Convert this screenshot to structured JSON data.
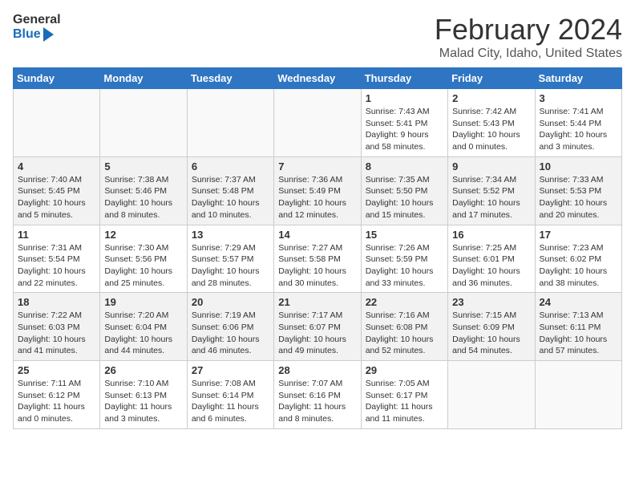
{
  "header": {
    "logo_general": "General",
    "logo_blue": "Blue",
    "month_title": "February 2024",
    "location": "Malad City, Idaho, United States"
  },
  "calendar": {
    "columns": [
      "Sunday",
      "Monday",
      "Tuesday",
      "Wednesday",
      "Thursday",
      "Friday",
      "Saturday"
    ],
    "rows": [
      {
        "shaded": false,
        "cells": [
          {
            "day": "",
            "info": ""
          },
          {
            "day": "",
            "info": ""
          },
          {
            "day": "",
            "info": ""
          },
          {
            "day": "",
            "info": ""
          },
          {
            "day": "1",
            "info": "Sunrise: 7:43 AM\nSunset: 5:41 PM\nDaylight: 9 hours and 58 minutes."
          },
          {
            "day": "2",
            "info": "Sunrise: 7:42 AM\nSunset: 5:43 PM\nDaylight: 10 hours and 0 minutes."
          },
          {
            "day": "3",
            "info": "Sunrise: 7:41 AM\nSunset: 5:44 PM\nDaylight: 10 hours and 3 minutes."
          }
        ]
      },
      {
        "shaded": true,
        "cells": [
          {
            "day": "4",
            "info": "Sunrise: 7:40 AM\nSunset: 5:45 PM\nDaylight: 10 hours and 5 minutes."
          },
          {
            "day": "5",
            "info": "Sunrise: 7:38 AM\nSunset: 5:46 PM\nDaylight: 10 hours and 8 minutes."
          },
          {
            "day": "6",
            "info": "Sunrise: 7:37 AM\nSunset: 5:48 PM\nDaylight: 10 hours and 10 minutes."
          },
          {
            "day": "7",
            "info": "Sunrise: 7:36 AM\nSunset: 5:49 PM\nDaylight: 10 hours and 12 minutes."
          },
          {
            "day": "8",
            "info": "Sunrise: 7:35 AM\nSunset: 5:50 PM\nDaylight: 10 hours and 15 minutes."
          },
          {
            "day": "9",
            "info": "Sunrise: 7:34 AM\nSunset: 5:52 PM\nDaylight: 10 hours and 17 minutes."
          },
          {
            "day": "10",
            "info": "Sunrise: 7:33 AM\nSunset: 5:53 PM\nDaylight: 10 hours and 20 minutes."
          }
        ]
      },
      {
        "shaded": false,
        "cells": [
          {
            "day": "11",
            "info": "Sunrise: 7:31 AM\nSunset: 5:54 PM\nDaylight: 10 hours and 22 minutes."
          },
          {
            "day": "12",
            "info": "Sunrise: 7:30 AM\nSunset: 5:56 PM\nDaylight: 10 hours and 25 minutes."
          },
          {
            "day": "13",
            "info": "Sunrise: 7:29 AM\nSunset: 5:57 PM\nDaylight: 10 hours and 28 minutes."
          },
          {
            "day": "14",
            "info": "Sunrise: 7:27 AM\nSunset: 5:58 PM\nDaylight: 10 hours and 30 minutes."
          },
          {
            "day": "15",
            "info": "Sunrise: 7:26 AM\nSunset: 5:59 PM\nDaylight: 10 hours and 33 minutes."
          },
          {
            "day": "16",
            "info": "Sunrise: 7:25 AM\nSunset: 6:01 PM\nDaylight: 10 hours and 36 minutes."
          },
          {
            "day": "17",
            "info": "Sunrise: 7:23 AM\nSunset: 6:02 PM\nDaylight: 10 hours and 38 minutes."
          }
        ]
      },
      {
        "shaded": true,
        "cells": [
          {
            "day": "18",
            "info": "Sunrise: 7:22 AM\nSunset: 6:03 PM\nDaylight: 10 hours and 41 minutes."
          },
          {
            "day": "19",
            "info": "Sunrise: 7:20 AM\nSunset: 6:04 PM\nDaylight: 10 hours and 44 minutes."
          },
          {
            "day": "20",
            "info": "Sunrise: 7:19 AM\nSunset: 6:06 PM\nDaylight: 10 hours and 46 minutes."
          },
          {
            "day": "21",
            "info": "Sunrise: 7:17 AM\nSunset: 6:07 PM\nDaylight: 10 hours and 49 minutes."
          },
          {
            "day": "22",
            "info": "Sunrise: 7:16 AM\nSunset: 6:08 PM\nDaylight: 10 hours and 52 minutes."
          },
          {
            "day": "23",
            "info": "Sunrise: 7:15 AM\nSunset: 6:09 PM\nDaylight: 10 hours and 54 minutes."
          },
          {
            "day": "24",
            "info": "Sunrise: 7:13 AM\nSunset: 6:11 PM\nDaylight: 10 hours and 57 minutes."
          }
        ]
      },
      {
        "shaded": false,
        "cells": [
          {
            "day": "25",
            "info": "Sunrise: 7:11 AM\nSunset: 6:12 PM\nDaylight: 11 hours and 0 minutes."
          },
          {
            "day": "26",
            "info": "Sunrise: 7:10 AM\nSunset: 6:13 PM\nDaylight: 11 hours and 3 minutes."
          },
          {
            "day": "27",
            "info": "Sunrise: 7:08 AM\nSunset: 6:14 PM\nDaylight: 11 hours and 6 minutes."
          },
          {
            "day": "28",
            "info": "Sunrise: 7:07 AM\nSunset: 6:16 PM\nDaylight: 11 hours and 8 minutes."
          },
          {
            "day": "29",
            "info": "Sunrise: 7:05 AM\nSunset: 6:17 PM\nDaylight: 11 hours and 11 minutes."
          },
          {
            "day": "",
            "info": ""
          },
          {
            "day": "",
            "info": ""
          }
        ]
      }
    ]
  }
}
